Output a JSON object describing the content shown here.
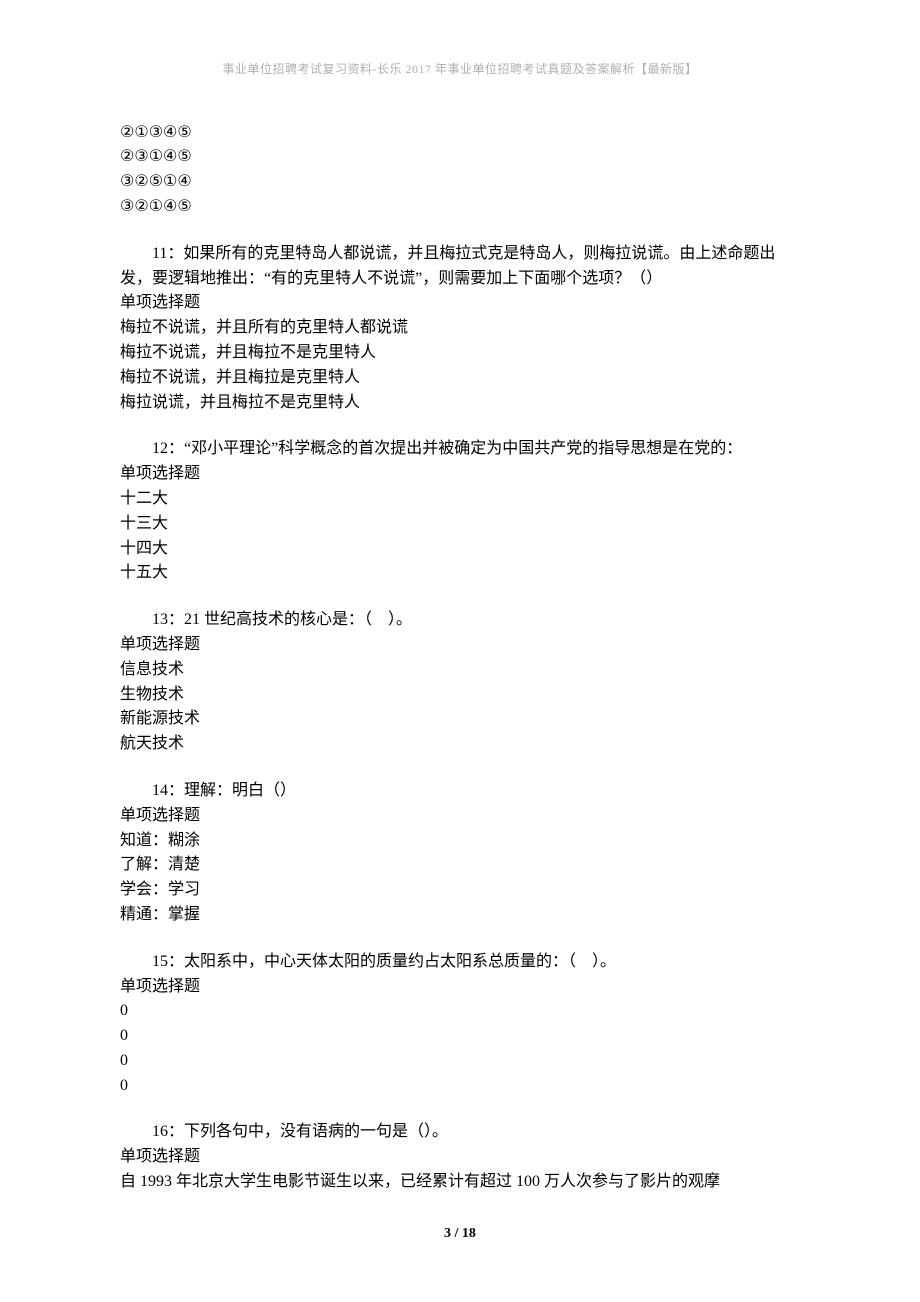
{
  "header": "事业单位招聘考试复习资料-长乐 2017 年事业单位招聘考试真题及答案解析【最新版】",
  "q10_opts": [
    "②①③④⑤",
    "②③①④⑤",
    "③②⑤①④",
    "③②①④⑤"
  ],
  "q11": {
    "stem": "11：如果所有的克里特岛人都说谎，并且梅拉式克是特岛人，则梅拉说谎。由上述命题出发，要逻辑地推出：“有的克里特人不说谎”，则需要加上下面哪个选项？（）",
    "type": "单项选择题",
    "opts": [
      "梅拉不说谎，并且所有的克里特人都说谎",
      "梅拉不说谎，并且梅拉不是克里特人",
      "梅拉不说谎，并且梅拉是克里特人",
      "梅拉说谎，并且梅拉不是克里特人"
    ]
  },
  "q12": {
    "stem": "12：“邓小平理论”科学概念的首次提出并被确定为中国共产党的指导思想是在党的：",
    "type": "单项选择题",
    "opts": [
      "十二大",
      "十三大",
      "十四大",
      "十五大"
    ]
  },
  "q13": {
    "stem": "13：21 世纪高技术的核心是：（　）。",
    "type": "单项选择题",
    "opts": [
      "信息技术",
      "生物技术",
      "新能源技术",
      "航天技术"
    ]
  },
  "q14": {
    "stem": "14：理解：明白（）",
    "type": "单项选择题",
    "opts": [
      "知道：糊涂",
      "了解：清楚",
      "学会：学习",
      "精通：掌握"
    ]
  },
  "q15": {
    "stem": "15：太阳系中，中心天体太阳的质量约占太阳系总质量的：（　）。",
    "type": "单项选择题",
    "opts": [
      "0",
      "0",
      "0",
      "0"
    ]
  },
  "q16": {
    "stem": "16：下列各句中，没有语病的一句是（）。",
    "type": "单项选择题",
    "opt1": "自 1993 年北京大学生电影节诞生以来，已经累计有超过 100 万人次参与了影片的观摩"
  },
  "footer": "3 / 18"
}
